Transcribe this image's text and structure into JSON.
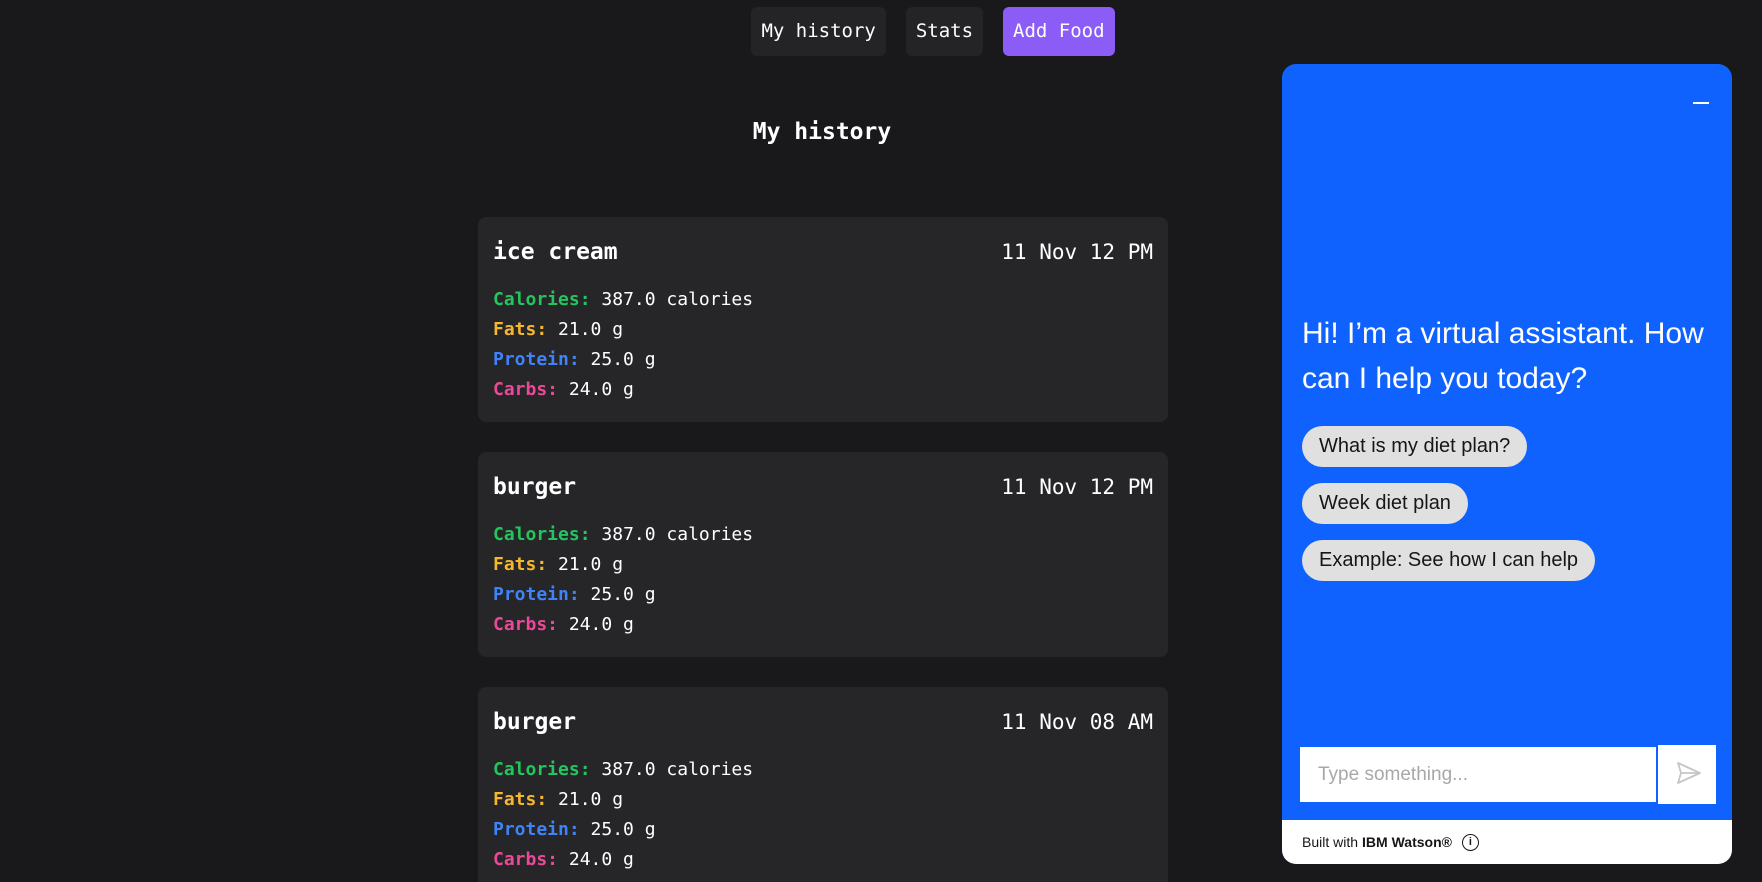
{
  "nav": {
    "items": [
      {
        "label": "My history"
      },
      {
        "label": "Stats"
      },
      {
        "label": "Add Food"
      }
    ]
  },
  "main": {
    "title": "My history",
    "nutrient_labels": {
      "calories": "Calories:",
      "fats": "Fats:",
      "protein": "Protein:",
      "carbs": "Carbs:"
    },
    "entries": [
      {
        "name": "ice cream",
        "time": "11 Nov 12 PM",
        "calories": "387.0 calories",
        "fats": "21.0 g",
        "protein": "25.0 g",
        "carbs": "24.0 g"
      },
      {
        "name": "burger",
        "time": "11 Nov 12 PM",
        "calories": "387.0 calories",
        "fats": "21.0 g",
        "protein": "25.0 g",
        "carbs": "24.0 g"
      },
      {
        "name": "burger",
        "time": "11 Nov 08 AM",
        "calories": "387.0 calories",
        "fats": "21.0 g",
        "protein": "25.0 g",
        "carbs": "24.0 g"
      }
    ]
  },
  "chat": {
    "greeting": "Hi! I’m a virtual assistant. How can I help you today?",
    "suggestions": [
      "What is my diet plan?",
      "Week diet plan",
      "Example: See how I can help"
    ],
    "input_placeholder": "Type something...",
    "footer_prefix": "Built with",
    "footer_brand": "IBM Watson®"
  },
  "colors": {
    "accent": "#8b5cf6",
    "chat_background": "#0f62fe",
    "calories": "#22c55e",
    "fats": "#f5b72f",
    "protein": "#3f83f8",
    "carbs": "#ec4899"
  },
  "icons": {
    "minimize": "minimize-icon",
    "send": "send-icon",
    "info": "info-icon"
  }
}
